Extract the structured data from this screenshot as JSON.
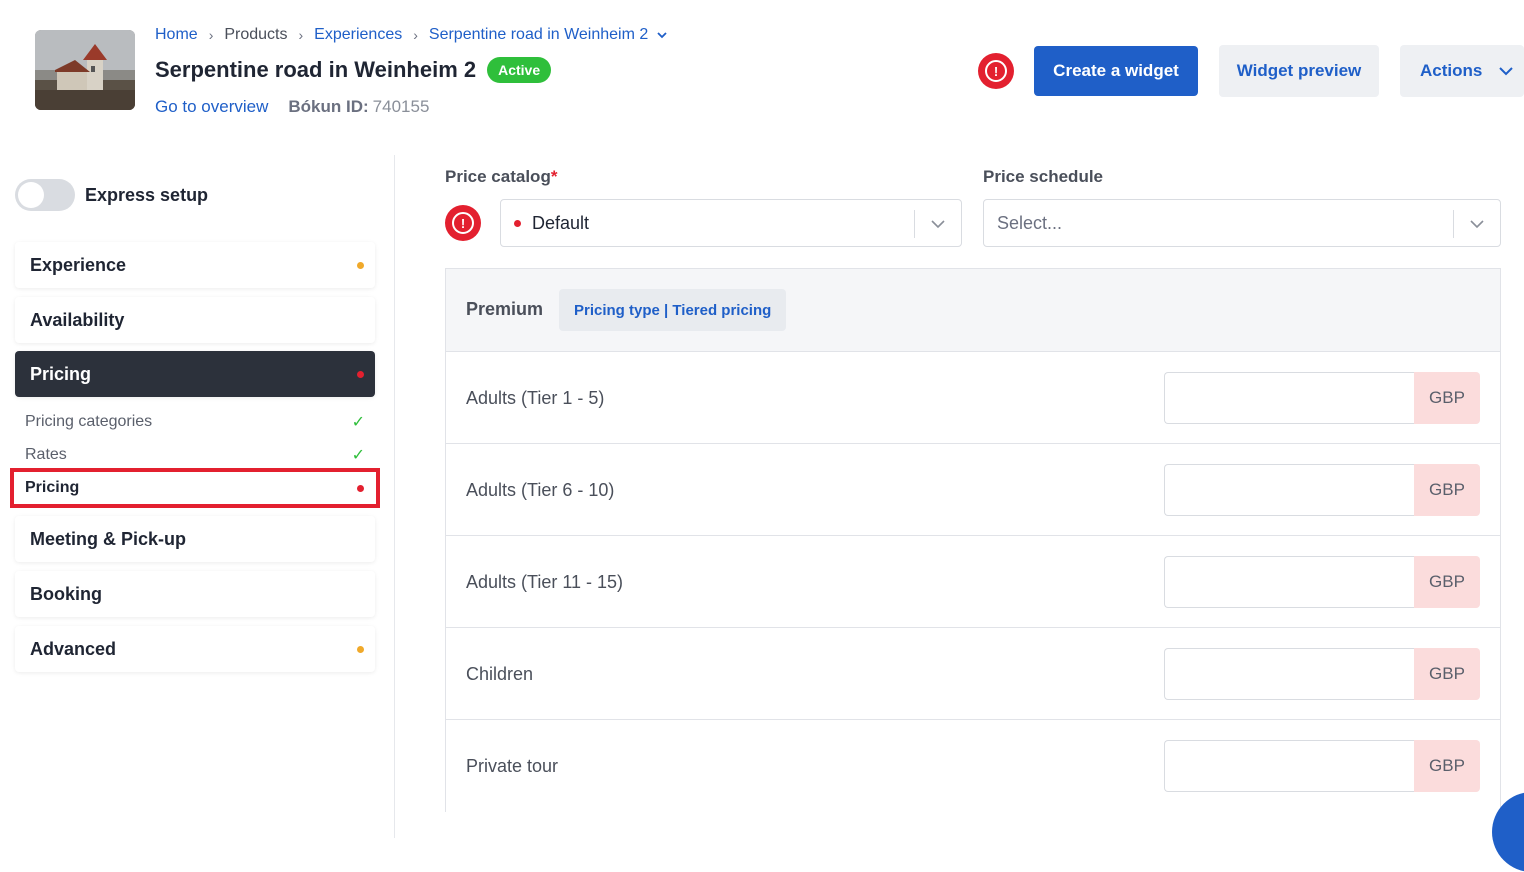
{
  "header": {
    "breadcrumb": {
      "home": "Home",
      "products": "Products",
      "experiences": "Experiences",
      "current": "Serpentine road in Weinheim 2"
    },
    "title": "Serpentine road in Weinheim 2",
    "status_badge": "Active",
    "go_to_overview": "Go to overview",
    "bokun_id_label": "Bókun ID:",
    "bokun_id_value": "740155",
    "create_widget": "Create a widget",
    "widget_preview": "Widget preview",
    "actions": "Actions"
  },
  "sidebar": {
    "express_setup": "Express setup",
    "items": [
      {
        "label": "Experience"
      },
      {
        "label": "Availability"
      },
      {
        "label": "Pricing"
      },
      {
        "label": "Meeting & Pick-up"
      },
      {
        "label": "Booking"
      },
      {
        "label": "Advanced"
      }
    ],
    "sub_items": [
      {
        "label": "Pricing categories"
      },
      {
        "label": "Rates"
      },
      {
        "label": "Pricing"
      }
    ]
  },
  "main": {
    "price_catalog_label": "Price catalog",
    "required_mark": "*",
    "price_catalog_value": "Default",
    "price_schedule_label": "Price schedule",
    "price_schedule_placeholder": "Select...",
    "panel": {
      "title": "Premium",
      "pricing_type_label": "Pricing type | Tiered pricing",
      "rows": [
        {
          "label": "Adults (Tier 1 - 5)",
          "currency": "GBP",
          "value": ""
        },
        {
          "label": "Adults (Tier 6 - 10)",
          "currency": "GBP",
          "value": ""
        },
        {
          "label": "Adults (Tier 11 - 15)",
          "currency": "GBP",
          "value": ""
        },
        {
          "label": "Children",
          "currency": "GBP",
          "value": ""
        },
        {
          "label": "Private tour",
          "currency": "GBP",
          "value": ""
        }
      ]
    }
  },
  "colors": {
    "primary": "#1f5fc8",
    "active_green": "#2fbf3b",
    "alert_red": "#e3202f",
    "warning_orange": "#f0a92a",
    "sidebar_active": "#2c313b",
    "currency_bg": "#fbdcdc"
  }
}
